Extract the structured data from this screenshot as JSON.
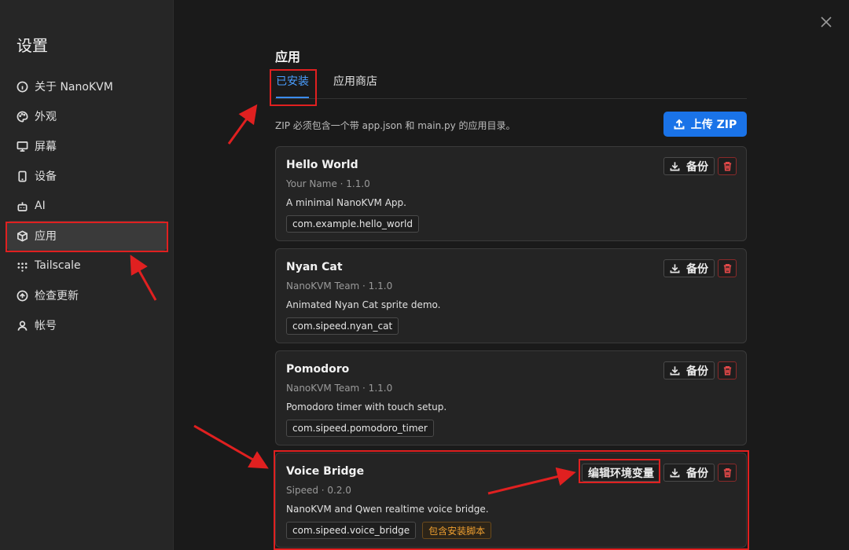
{
  "sidebar": {
    "title": "设置",
    "items": [
      {
        "label": "关于 NanoKVM",
        "icon": "info-icon"
      },
      {
        "label": "外观",
        "icon": "palette-icon"
      },
      {
        "label": "屏幕",
        "icon": "monitor-icon"
      },
      {
        "label": "设备",
        "icon": "device-icon"
      },
      {
        "label": "AI",
        "icon": "bot-icon"
      },
      {
        "label": "应用",
        "icon": "package-icon",
        "active": true
      },
      {
        "label": "Tailscale",
        "icon": "tailscale-icon"
      },
      {
        "label": "检查更新",
        "icon": "update-icon"
      },
      {
        "label": "帐号",
        "icon": "user-icon"
      }
    ]
  },
  "main": {
    "title": "应用",
    "tabs": [
      {
        "label": "已安装",
        "active": true
      },
      {
        "label": "应用商店"
      }
    ],
    "description": "ZIP 必须包含一个带 app.json 和 main.py 的应用目录。",
    "upload_label": "上传 ZIP",
    "backup_label": "备份",
    "edit_env_label": "编辑环境变量",
    "apps": [
      {
        "name": "Hello World",
        "meta": "Your Name · 1.1.0",
        "description": "A minimal NanoKVM App.",
        "id": "com.example.hello_world"
      },
      {
        "name": "Nyan Cat",
        "meta": "NanoKVM Team · 1.1.0",
        "description": "Animated Nyan Cat sprite demo.",
        "id": "com.sipeed.nyan_cat"
      },
      {
        "name": "Pomodoro",
        "meta": "NanoKVM Team · 1.1.0",
        "description": "Pomodoro timer with touch setup.",
        "id": "com.sipeed.pomodoro_timer"
      },
      {
        "name": "Voice Bridge",
        "meta": "Sipeed · 0.2.0",
        "description": "NanoKVM and Qwen realtime voice bridge.",
        "id": "com.sipeed.voice_bridge",
        "badge": "包含安装脚本"
      }
    ]
  },
  "colors": {
    "accent": "#1a73e8",
    "annotation": "#e02020",
    "danger": "#e04848",
    "warning": "#f0a030"
  }
}
